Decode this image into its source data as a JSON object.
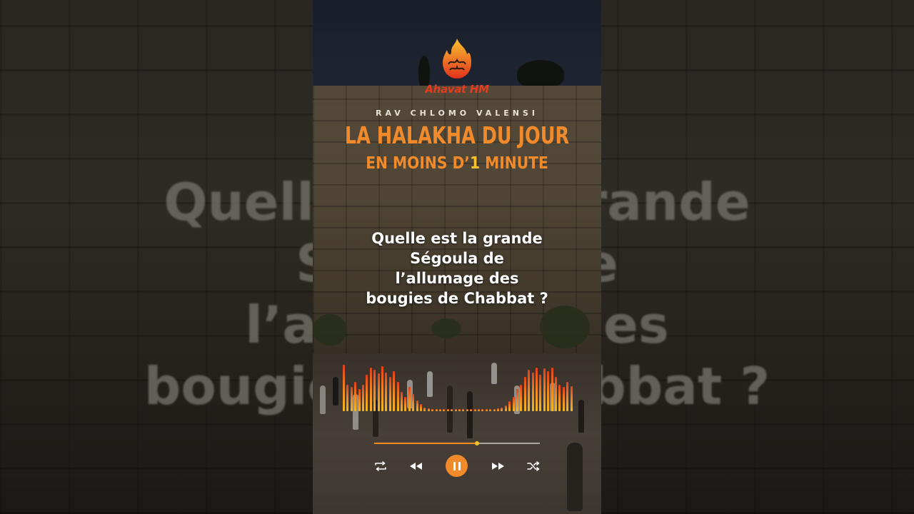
{
  "brand": {
    "name": "Ahavat HM",
    "color": "#e53b1f"
  },
  "author": "RAV CHLOMO VALENSI",
  "title": "LA HALAKHA DU JOUR",
  "subtitle": {
    "before": "EN MOINS D’",
    "number": "1",
    "after": " MINUTE"
  },
  "question": [
    "Quelle est la grande",
    "Ségoula de",
    "l’allumage des",
    "bougies de Chabbat ?"
  ],
  "background_text": [
    "Quelle est la grande",
    "Ségoula de",
    "l’allumage des",
    "bougies de Chabbat ?"
  ],
  "player": {
    "progress": 0.62,
    "controls": [
      "repeat-icon",
      "rewind-icon",
      "pause-icon",
      "fast-forward-icon",
      "shuffle-icon"
    ],
    "state": "playing"
  },
  "visualizer": {
    "levels": [
      0.95,
      0.55,
      0.5,
      0.6,
      0.45,
      0.55,
      0.75,
      0.9,
      0.85,
      0.78,
      0.92,
      0.8,
      0.7,
      0.82,
      0.6,
      0.4,
      0.3,
      0.5,
      0.35,
      0.22,
      0.15,
      0.08,
      0.06,
      0.05,
      0.05,
      0.05,
      0.05,
      0.05,
      0.05,
      0.05,
      0.05,
      0.05,
      0.05,
      0.05,
      0.05,
      0.05,
      0.05,
      0.05,
      0.05,
      0.05,
      0.06,
      0.08,
      0.12,
      0.2,
      0.3,
      0.45,
      0.55,
      0.7,
      0.85,
      0.8,
      0.9,
      0.75,
      0.88,
      0.82,
      0.9,
      0.7,
      0.55,
      0.5,
      0.6,
      0.52
    ]
  },
  "colors": {
    "accent": "#f08a2a",
    "highlight": "#f6c12c",
    "text": "#ffffff"
  }
}
